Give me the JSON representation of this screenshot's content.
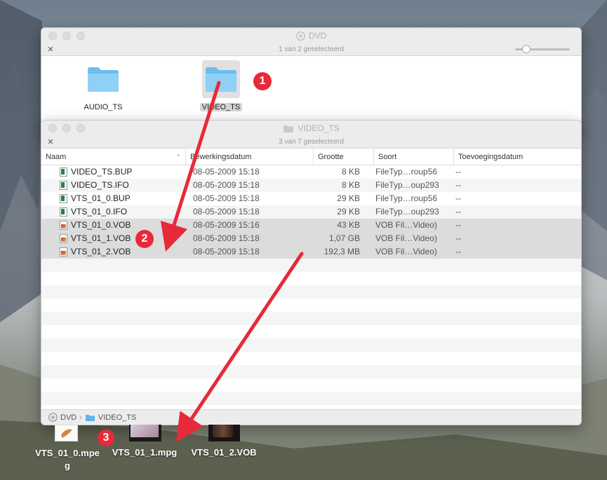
{
  "windows": {
    "dvd": {
      "title": "DVD",
      "status": "1 van 2 geselecteerd",
      "items": [
        {
          "label": "AUDIO_TS",
          "selected": false
        },
        {
          "label": "VIDEO_TS",
          "selected": true
        }
      ]
    },
    "video_ts": {
      "title": "VIDEO_TS",
      "status": "3 van 7 geselecteerd",
      "columns": {
        "name": "Naam",
        "date": "Bewerkingsdatum",
        "size": "Grootte",
        "kind": "Soort",
        "added": "Toevoegingsdatum"
      },
      "rows": [
        {
          "name": "VIDEO_TS.BUP",
          "date": "08-05-2009 15:18",
          "size": "8 KB",
          "kind": "FileTyp…roup56",
          "added": "--",
          "icon": "doc-icon",
          "selected": false
        },
        {
          "name": "VIDEO_TS.IFO",
          "date": "08-05-2009 15:18",
          "size": "8 KB",
          "kind": "FileTyp…oup293",
          "added": "--",
          "icon": "doc-icon",
          "selected": false
        },
        {
          "name": "VTS_01_0.BUP",
          "date": "08-05-2009 15:18",
          "size": "29 KB",
          "kind": "FileTyp…roup56",
          "added": "--",
          "icon": "doc-icon",
          "selected": false
        },
        {
          "name": "VTS_01_0.IFO",
          "date": "08-05-2009 15:18",
          "size": "29 KB",
          "kind": "FileTyp…oup293",
          "added": "--",
          "icon": "doc-icon",
          "selected": false
        },
        {
          "name": "VTS_01_0.VOB",
          "date": "08-05-2009 15:16",
          "size": "43 KB",
          "kind": "VOB Fil…Video)",
          "added": "--",
          "icon": "vob-icon",
          "selected": true
        },
        {
          "name": "VTS_01_1.VOB",
          "date": "08-05-2009 15:18",
          "size": "1,07 GB",
          "kind": "VOB Fil…Video)",
          "added": "--",
          "icon": "vob-icon",
          "selected": true
        },
        {
          "name": "VTS_01_2.VOB",
          "date": "08-05-2009 15:18",
          "size": "192,3 MB",
          "kind": "VOB Fil…Video)",
          "added": "--",
          "icon": "vob-icon",
          "selected": true
        }
      ],
      "path": {
        "root": "DVD",
        "separator": "›",
        "folder": "VIDEO_TS"
      }
    }
  },
  "badges": [
    "1",
    "2",
    "3"
  ],
  "desktop": {
    "files": [
      {
        "label": "VTS_01_0.mpe\ng"
      },
      {
        "label": "VTS_01_1.mpg"
      },
      {
        "label": "VTS_01_2.VOB"
      }
    ]
  },
  "colors": {
    "badge": "#e8293a",
    "arrow": "#e8293a",
    "folder": "#5fb5ec"
  }
}
